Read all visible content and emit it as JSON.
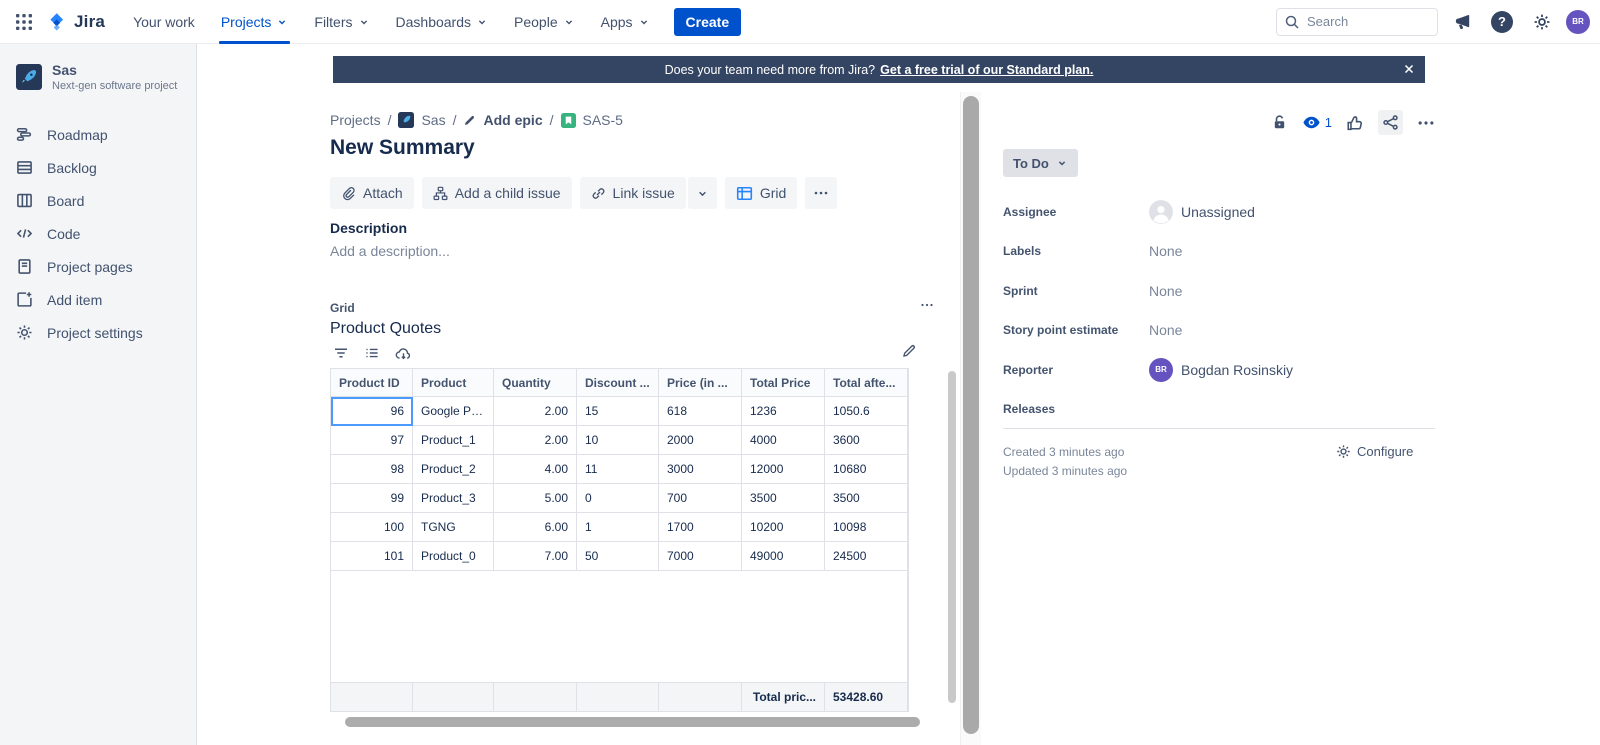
{
  "nav": {
    "brand": "Jira",
    "items": [
      {
        "label": "Your work",
        "has_dropdown": false,
        "active": false
      },
      {
        "label": "Projects",
        "has_dropdown": true,
        "active": true
      },
      {
        "label": "Filters",
        "has_dropdown": true,
        "active": false
      },
      {
        "label": "Dashboards",
        "has_dropdown": true,
        "active": false
      },
      {
        "label": "People",
        "has_dropdown": true,
        "active": false
      },
      {
        "label": "Apps",
        "has_dropdown": true,
        "active": false
      }
    ],
    "create_label": "Create",
    "search_placeholder": "Search",
    "help_glyph": "?",
    "avatar_initials": "BR"
  },
  "sidebar": {
    "project_name": "Sas",
    "project_type": "Next-gen software project",
    "items": [
      {
        "label": "Roadmap"
      },
      {
        "label": "Backlog"
      },
      {
        "label": "Board"
      },
      {
        "label": "Code"
      },
      {
        "label": "Project pages"
      },
      {
        "label": "Add item"
      },
      {
        "label": "Project settings"
      }
    ]
  },
  "banner": {
    "text": "Does your team need more from Jira?",
    "link_text": "Get a free trial of our Standard plan."
  },
  "breadcrumb": {
    "level1": "Projects",
    "level2": "Sas",
    "level3": "Add epic",
    "level4": "SAS-5"
  },
  "issue": {
    "title": "New Summary",
    "toolbar": {
      "attach": "Attach",
      "add_child": "Add a child issue",
      "link_issue": "Link issue",
      "grid": "Grid"
    },
    "description_label": "Description",
    "description_placeholder": "Add a description...",
    "grid_panel": {
      "label": "Grid",
      "title": "Product Quotes",
      "table": {
        "columns": [
          "Product ID",
          "Product",
          "Quantity",
          "Discount ...",
          "Price (in ...",
          "Total Price",
          "Total afte..."
        ],
        "rows": [
          [
            "96",
            "Google Pix...",
            "2.00",
            "15",
            "618",
            "1236",
            "1050.6"
          ],
          [
            "97",
            "Product_1",
            "2.00",
            "10",
            "2000",
            "4000",
            "3600"
          ],
          [
            "98",
            "Product_2",
            "4.00",
            "11",
            "3000",
            "12000",
            "10680"
          ],
          [
            "99",
            "Product_3",
            "5.00",
            "0",
            "700",
            "3500",
            "3500"
          ],
          [
            "100",
            "TGNG",
            "6.00",
            "1",
            "1700",
            "10200",
            "10098"
          ],
          [
            "101",
            "Product_0",
            "7.00",
            "50",
            "7000",
            "49000",
            "24500"
          ]
        ],
        "footer_label": "Total pric...",
        "footer_value": "53428.60"
      }
    }
  },
  "details": {
    "status": "To Do",
    "watchers_count": "1",
    "fields": [
      {
        "label": "Assignee",
        "value": "Unassigned"
      },
      {
        "label": "Labels",
        "value": "None"
      },
      {
        "label": "Sprint",
        "value": "None"
      },
      {
        "label": "Story point estimate",
        "value": "None"
      },
      {
        "label": "Reporter",
        "value": "Bogdan Rosinskiy",
        "avatar_initials": "BR"
      },
      {
        "label": "Releases",
        "value": ""
      }
    ],
    "created": "Created 3 minutes ago",
    "updated": "Updated 3 minutes ago",
    "configure_label": "Configure"
  },
  "colors": {
    "accent": "#0052CC",
    "banner_bg": "#344563",
    "avatar_purple": "#6554C0",
    "status_bg": "#DFE1E6",
    "selected_cell_border": "#4C9AFF",
    "story_icon_green": "#36B37E"
  }
}
